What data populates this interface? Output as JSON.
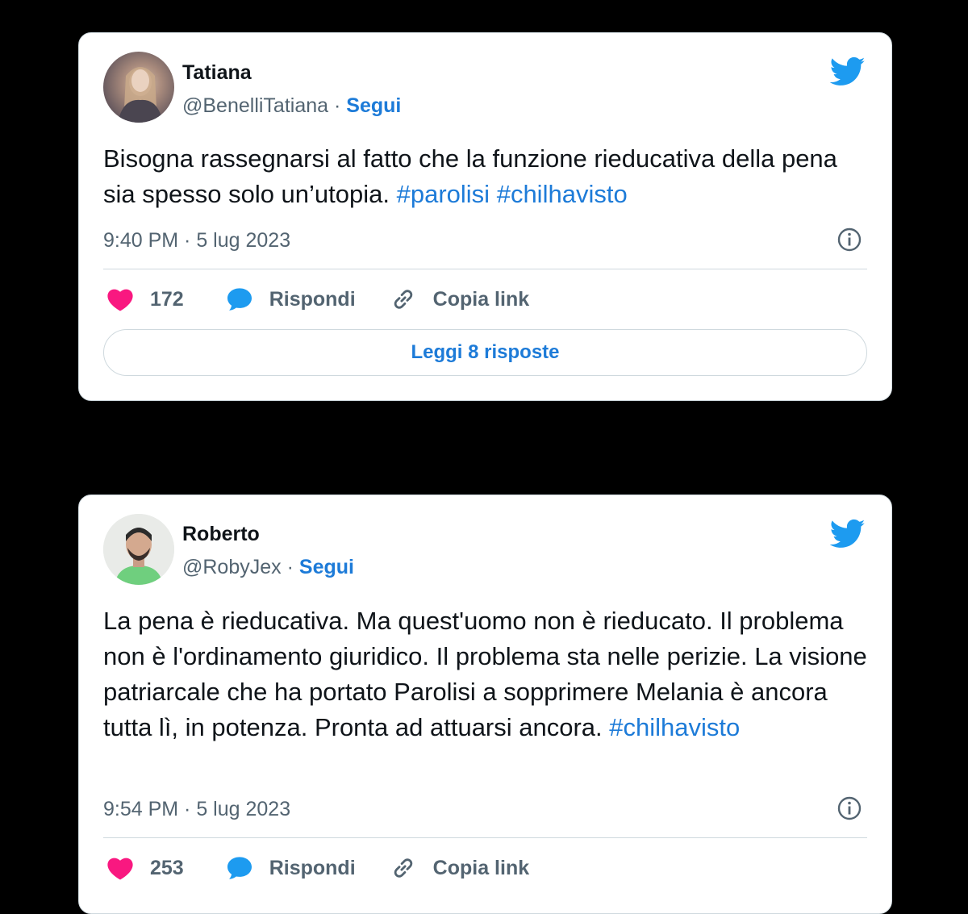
{
  "tweets": [
    {
      "name": "Tatiana",
      "handle": "@BenelliTatiana",
      "separator": "·",
      "follow_label": "Segui",
      "text_plain": "Bisogna rassegnarsi al fatto che la funzione rieducativa della pena sia spesso solo un’utopia. ",
      "hashtags": [
        "#parolisi",
        "#chilhavisto"
      ],
      "timestamp": "9:40 PM · 5 lug 2023",
      "likes": "172",
      "reply_label": "Rispondi",
      "copy_label": "Copia link",
      "read_replies_label": "Leggi 8 risposte"
    },
    {
      "name": "Roberto",
      "handle": "@RobyJex",
      "separator": "·",
      "follow_label": "Segui",
      "text_plain": "La pena è rieducativa. Ma quest'uomo non è rieducato. Il problema non è l'ordinamento giuridico. Il problema sta nelle perizie. La visione patriarcale che ha portato Parolisi a sopprimere Melania è ancora tutta lì, in potenza. Pronta ad attuarsi ancora. ",
      "hashtags": [
        "#chilhavisto"
      ],
      "timestamp": "9:54 PM · 5 lug 2023",
      "likes": "253",
      "reply_label": "Rispondi",
      "copy_label": "Copia link"
    }
  ],
  "colors": {
    "background": "#000000",
    "card": "#ffffff",
    "link_blue": "#1d7bd8",
    "twitter_blue": "#1d9bf0",
    "heart": "#f91880",
    "muted_text": "#536471"
  },
  "icons": {
    "brand": "twitter-bird-icon",
    "like": "heart-icon",
    "reply": "speech-bubble-icon",
    "copy": "link-icon",
    "info": "info-icon"
  }
}
